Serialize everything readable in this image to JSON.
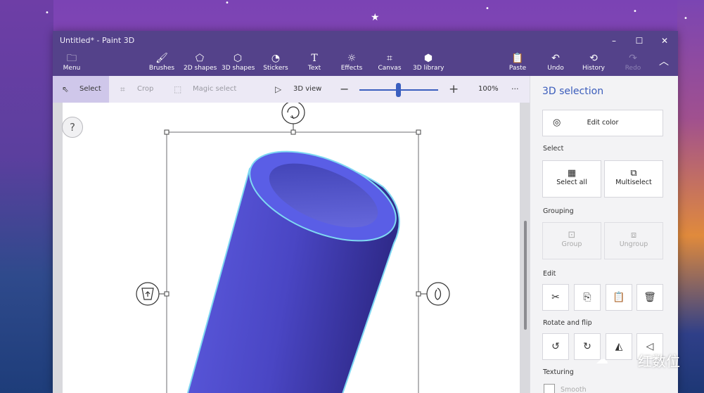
{
  "window": {
    "title": "Untitled* - Paint 3D",
    "controls": [
      "–",
      "☐",
      "✕"
    ]
  },
  "toolbar": {
    "menu": "Menu",
    "brushes": "Brushes",
    "shapes2d": "2D shapes",
    "shapes3d": "3D shapes",
    "stickers": "Stickers",
    "text": "Text",
    "effects": "Effects",
    "canvas": "Canvas",
    "library3d": "3D library",
    "paste": "Paste",
    "undo": "Undo",
    "history": "History",
    "redo": "Redo"
  },
  "selbar": {
    "select": "Select",
    "crop": "Crop",
    "magic_select": "Magic select",
    "view3d": "3D view",
    "zoom": "100%",
    "zoom_level": 0.5,
    "more": "···"
  },
  "canvas": {
    "help": "?"
  },
  "panel": {
    "title": "3D selection",
    "edit_color": "Edit color",
    "select_label": "Select",
    "select_all": "Select all",
    "multiselect": "Multiselect",
    "grouping_label": "Grouping",
    "group": "Group",
    "ungroup": "Ungroup",
    "edit_label": "Edit",
    "rotate_label": "Rotate and flip",
    "texturing_label": "Texturing",
    "smooth": "Smooth"
  },
  "watermark": "红数位",
  "colors": {
    "accent": "#3a5cbb",
    "titlebar": "#54428a",
    "model": "#5b57d6"
  }
}
